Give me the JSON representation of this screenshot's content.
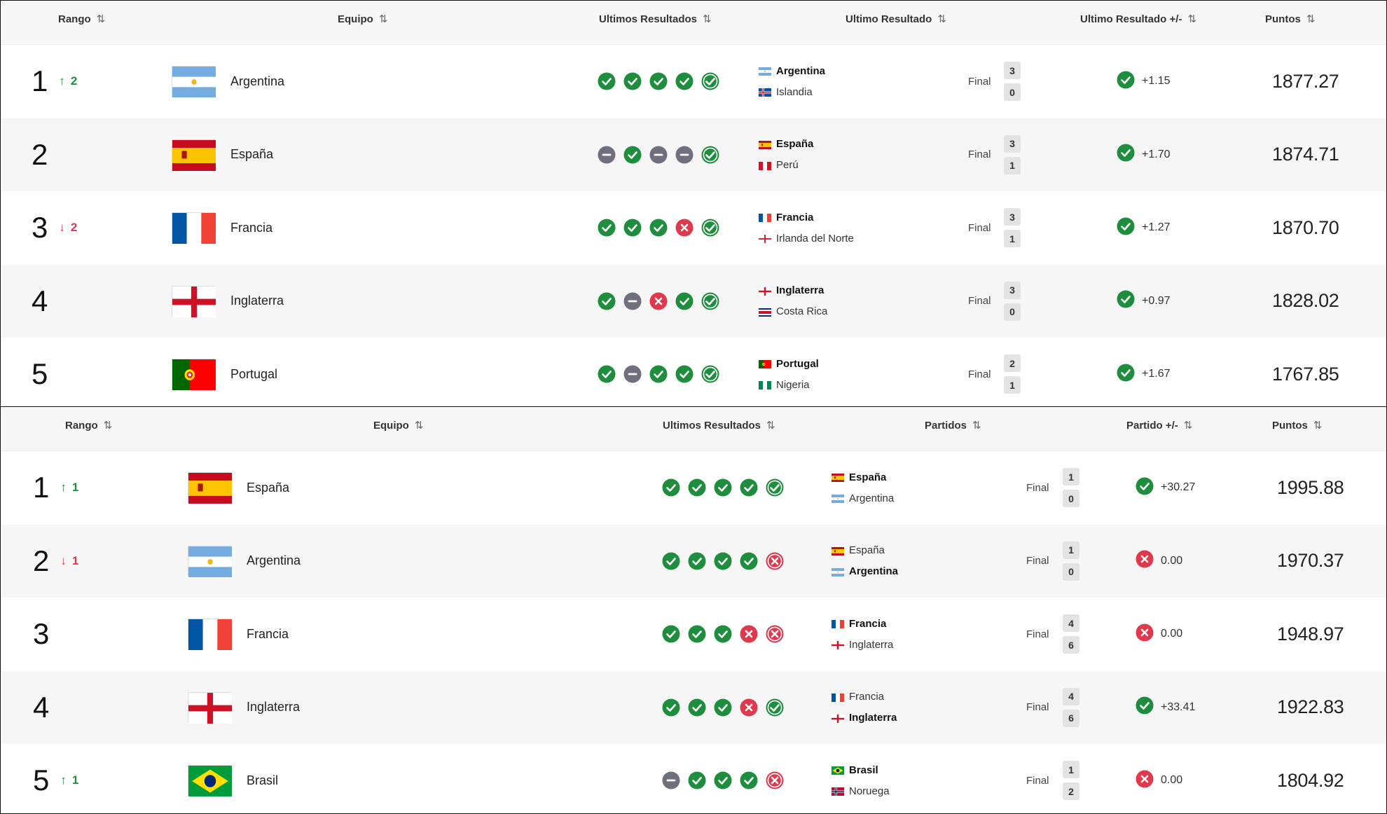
{
  "colors": {
    "win": "#1e8e3e",
    "loss": "#e0394e",
    "draw": "#6f6f7d",
    "up": "#1e8e3e",
    "down": "#e0394e"
  },
  "icons": {
    "sort": "sort-arrows-icon",
    "up": "arrow-up-icon",
    "down": "arrow-down-icon",
    "win": "check-circle-icon",
    "loss": "x-circle-icon",
    "draw": "minus-circle-icon"
  },
  "panels": [
    {
      "headers": {
        "rank": "Rango",
        "team": "Equipo",
        "last_results": "Ultimos Resultados",
        "match": "Ultimo Resultado",
        "delta": "Ultimo Resultado +/-",
        "points": "Puntos"
      },
      "rows": [
        {
          "rank": "1",
          "change": {
            "dir": "up",
            "value": "2"
          },
          "team": "Argentina",
          "flag": "ARG",
          "results": [
            "W",
            "W",
            "W",
            "W",
            "Wl"
          ],
          "match": {
            "home": "Argentina",
            "home_flag": "ARG",
            "away": "Islandia",
            "away_flag": "ISL",
            "bold": "home",
            "status": "Final",
            "home_score": "3",
            "away_score": "0"
          },
          "delta": {
            "result": "W",
            "value": "+1.15"
          },
          "points": "1877.27"
        },
        {
          "rank": "2",
          "change": null,
          "team": "España",
          "flag": "ESP",
          "results": [
            "D",
            "W",
            "D",
            "D",
            "Wl"
          ],
          "match": {
            "home": "España",
            "home_flag": "ESP",
            "away": "Perú",
            "away_flag": "PER",
            "bold": "home",
            "status": "Final",
            "home_score": "3",
            "away_score": "1"
          },
          "delta": {
            "result": "W",
            "value": "+1.70"
          },
          "points": "1874.71"
        },
        {
          "rank": "3",
          "change": {
            "dir": "down",
            "value": "2"
          },
          "team": "Francia",
          "flag": "FRA",
          "results": [
            "W",
            "W",
            "W",
            "L",
            "Wl"
          ],
          "match": {
            "home": "Francia",
            "home_flag": "FRA",
            "away": "Irlanda del Norte",
            "away_flag": "NIR",
            "bold": "home",
            "status": "Final",
            "home_score": "3",
            "away_score": "1"
          },
          "delta": {
            "result": "W",
            "value": "+1.27"
          },
          "points": "1870.70"
        },
        {
          "rank": "4",
          "change": null,
          "team": "Inglaterra",
          "flag": "ENG",
          "results": [
            "W",
            "D",
            "L",
            "W",
            "Wl"
          ],
          "match": {
            "home": "Inglaterra",
            "home_flag": "ENG",
            "away": "Costa Rica",
            "away_flag": "CRC",
            "bold": "home",
            "status": "Final",
            "home_score": "3",
            "away_score": "0"
          },
          "delta": {
            "result": "W",
            "value": "+0.97"
          },
          "points": "1828.02"
        },
        {
          "rank": "5",
          "change": null,
          "team": "Portugal",
          "flag": "POR",
          "results": [
            "W",
            "D",
            "W",
            "W",
            "Wl"
          ],
          "match": {
            "home": "Portugal",
            "home_flag": "POR",
            "away": "Nigeria",
            "away_flag": "NGA",
            "bold": "home",
            "status": "Final",
            "home_score": "2",
            "away_score": "1"
          },
          "delta": {
            "result": "W",
            "value": "+1.67"
          },
          "points": "1767.85"
        }
      ]
    },
    {
      "headers": {
        "rank": "Rango",
        "team": "Equipo",
        "last_results": "Ultimos Resultados",
        "match": "Partidos",
        "delta": "Partido +/-",
        "points": "Puntos"
      },
      "rows": [
        {
          "rank": "1",
          "change": {
            "dir": "up",
            "value": "1"
          },
          "team": "España",
          "flag": "ESP",
          "results": [
            "W",
            "W",
            "W",
            "W",
            "Wl"
          ],
          "match": {
            "home": "España",
            "home_flag": "ESP",
            "away": "Argentina",
            "away_flag": "ARG",
            "bold": "home",
            "status": "Final",
            "home_score": "1",
            "away_score": "0"
          },
          "delta": {
            "result": "W",
            "value": "+30.27"
          },
          "points": "1995.88"
        },
        {
          "rank": "2",
          "change": {
            "dir": "down",
            "value": "1"
          },
          "team": "Argentina",
          "flag": "ARG",
          "results": [
            "W",
            "W",
            "W",
            "W",
            "Ll"
          ],
          "match": {
            "home": "España",
            "home_flag": "ESP",
            "away": "Argentina",
            "away_flag": "ARG",
            "bold": "away",
            "status": "Final",
            "home_score": "1",
            "away_score": "0"
          },
          "delta": {
            "result": "L",
            "value": "0.00"
          },
          "points": "1970.37"
        },
        {
          "rank": "3",
          "change": null,
          "team": "Francia",
          "flag": "FRA",
          "results": [
            "W",
            "W",
            "W",
            "L",
            "Ll"
          ],
          "match": {
            "home": "Francia",
            "home_flag": "FRA",
            "away": "Inglaterra",
            "away_flag": "ENG",
            "bold": "home",
            "status": "Final",
            "home_score": "4",
            "away_score": "6"
          },
          "delta": {
            "result": "L",
            "value": "0.00"
          },
          "points": "1948.97"
        },
        {
          "rank": "4",
          "change": null,
          "team": "Inglaterra",
          "flag": "ENG",
          "results": [
            "W",
            "W",
            "W",
            "L",
            "Wl"
          ],
          "match": {
            "home": "Francia",
            "home_flag": "FRA",
            "away": "Inglaterra",
            "away_flag": "ENG",
            "bold": "away",
            "status": "Final",
            "home_score": "4",
            "away_score": "6"
          },
          "delta": {
            "result": "W",
            "value": "+33.41"
          },
          "points": "1922.83"
        },
        {
          "rank": "5",
          "change": {
            "dir": "up",
            "value": "1"
          },
          "team": "Brasil",
          "flag": "BRA",
          "results": [
            "D",
            "W",
            "W",
            "W",
            "Ll"
          ],
          "match": {
            "home": "Brasil",
            "home_flag": "BRA",
            "away": "Noruega",
            "away_flag": "NOR",
            "bold": "home",
            "status": "Final",
            "home_score": "1",
            "away_score": "2"
          },
          "delta": {
            "result": "L",
            "value": "0.00"
          },
          "points": "1804.92"
        }
      ]
    }
  ]
}
